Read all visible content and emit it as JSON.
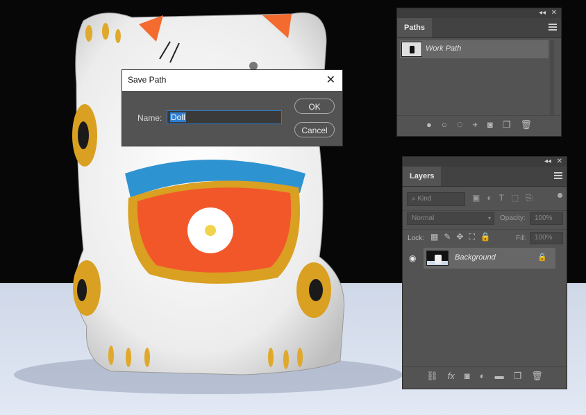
{
  "dialog": {
    "title": "Save Path",
    "name_label": "Name:",
    "name_value": "Doll",
    "ok_label": "OK",
    "cancel_label": "Cancel"
  },
  "paths_panel": {
    "tab": "Paths",
    "items": [
      {
        "label": "Work Path"
      }
    ],
    "bottom_icons": [
      "fill-path-icon",
      "stroke-path-icon",
      "load-selection-icon",
      "make-work-path-icon",
      "add-mask-icon",
      "new-path-icon",
      "delete-path-icon"
    ]
  },
  "layers_panel": {
    "tab": "Layers",
    "filter_kind": "Kind",
    "blend_mode": "Normal",
    "opacity_label": "Opacity:",
    "opacity_value": "100%",
    "lock_label": "Lock:",
    "fill_label": "Fill:",
    "fill_value": "100%",
    "layers": [
      {
        "name": "Background",
        "visible": true,
        "locked": true
      }
    ],
    "bottom_icons": [
      "link-icon",
      "fx-icon",
      "mask-icon",
      "adjustment-icon",
      "group-icon",
      "new-layer-icon",
      "delete-icon"
    ]
  },
  "colors": {
    "panel": "#535353",
    "accent": "#3d7fc9"
  }
}
